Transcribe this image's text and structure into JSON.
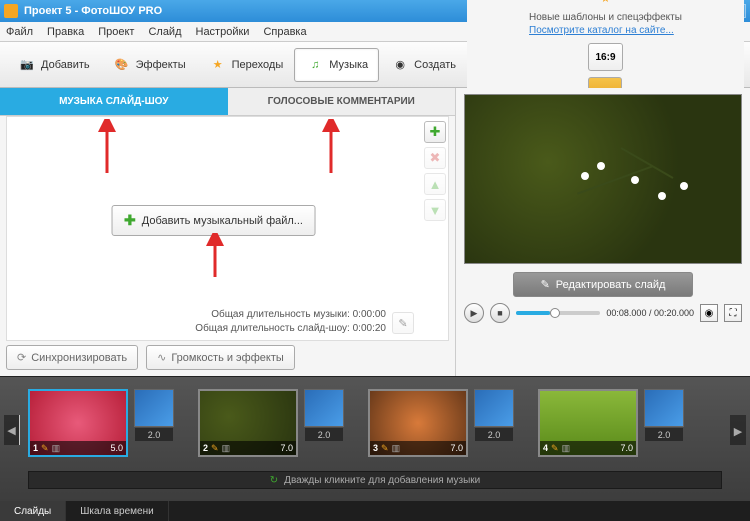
{
  "window": {
    "title": "Проект 5 - ФотоШОУ PRO"
  },
  "menu": {
    "file": "Файл",
    "edit": "Правка",
    "project": "Проект",
    "slide": "Слайд",
    "settings": "Настройки",
    "help": "Справка"
  },
  "toolbar": {
    "add": "Добавить",
    "effects": "Эффекты",
    "transitions": "Переходы",
    "music": "Музыка",
    "create": "Создать",
    "promo1": "Новые шаблоны и спецэффекты",
    "promo2": "Посмотрите каталог на сайте...",
    "aspect": "16:9"
  },
  "music": {
    "tab_slideshow": "МУЗЫКА СЛАЙД-ШОУ",
    "tab_voice": "ГОЛОСОВЫЕ КОММЕНТАРИИ",
    "add_file": "Добавить музыкальный файл...",
    "dur_music_label": "Общая длительность музыки:",
    "dur_music_value": "0:00:00",
    "dur_show_label": "Общая длительность слайд-шоу:",
    "dur_show_value": "0:00:20",
    "sync": "Синхронизировать",
    "volume": "Громкость и эффекты"
  },
  "preview": {
    "edit": "Редактировать слайд",
    "time": "00:08.000 / 00:20.000"
  },
  "timeline": {
    "slides": [
      {
        "num": "1",
        "dur": "5.0",
        "trans": "2.0",
        "bg": "radial-gradient(circle,#e85a7a,#b8203a)"
      },
      {
        "num": "2",
        "dur": "7.0",
        "trans": "2.0",
        "bg": "radial-gradient(circle at 30% 40%,#4a5a1a,#2a3510)"
      },
      {
        "num": "3",
        "dur": "7.0",
        "trans": "2.0",
        "bg": "radial-gradient(circle,#d87a3a,#6a3a1a)"
      },
      {
        "num": "4",
        "dur": "7.0",
        "trans": "2.0",
        "bg": "linear-gradient(#8ab83a,#5a8a1a)"
      }
    ],
    "music_hint": "Дважды кликните для добавления музыки"
  },
  "footer": {
    "slides": "Слайды",
    "timeline": "Шкала времени"
  }
}
